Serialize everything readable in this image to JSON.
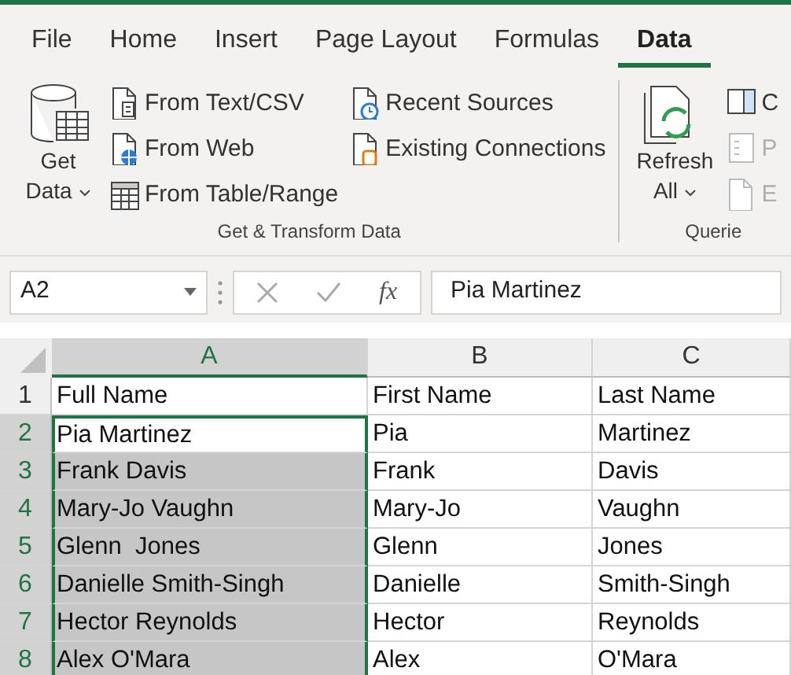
{
  "tabs": [
    {
      "label": "File",
      "selected": false
    },
    {
      "label": "Home",
      "selected": false
    },
    {
      "label": "Insert",
      "selected": false
    },
    {
      "label": "Page Layout",
      "selected": false
    },
    {
      "label": "Formulas",
      "selected": false
    },
    {
      "label": "Data",
      "selected": true
    }
  ],
  "ribbon": {
    "groups": [
      {
        "label": "Get & Transform Data",
        "large": [
          {
            "label": "Get Data",
            "caret": true
          }
        ],
        "columns": [
          [
            {
              "label": "From Text/CSV",
              "disabled": false
            },
            {
              "label": "From Web",
              "disabled": false
            },
            {
              "label": "From Table/Range",
              "disabled": false
            }
          ],
          [
            {
              "label": "Recent Sources",
              "disabled": false
            },
            {
              "label": "Existing Connections",
              "disabled": false
            }
          ]
        ]
      },
      {
        "label": "Querie",
        "large": [
          {
            "label": "Refresh All",
            "caret": true
          }
        ],
        "columns": [
          [
            {
              "label": "C",
              "disabled": false
            },
            {
              "label": "P",
              "disabled": true
            },
            {
              "label": "E",
              "disabled": true
            }
          ]
        ]
      }
    ]
  },
  "formula_bar": {
    "name_box": "A2",
    "function_label": "fx",
    "value": "Pia Martinez"
  },
  "sheet": {
    "columns": [
      {
        "label": "A",
        "selected": true
      },
      {
        "label": "B",
        "selected": false
      },
      {
        "label": "C",
        "selected": false
      }
    ],
    "rows": [
      {
        "header": "1",
        "selected": false,
        "cells": [
          {
            "text": "Full Name",
            "selected": false,
            "active": false
          },
          {
            "text": "First Name",
            "selected": false,
            "active": false
          },
          {
            "text": "Last Name",
            "selected": false,
            "active": false
          }
        ]
      },
      {
        "header": "2",
        "selected": true,
        "cells": [
          {
            "text": "Pia Martinez",
            "selected": true,
            "active": true
          },
          {
            "text": "Pia",
            "selected": false,
            "active": false
          },
          {
            "text": "Martinez",
            "selected": false,
            "active": false
          }
        ]
      },
      {
        "header": "3",
        "selected": true,
        "cells": [
          {
            "text": "Frank Davis",
            "selected": true,
            "active": false
          },
          {
            "text": "Frank",
            "selected": false,
            "active": false
          },
          {
            "text": "Davis",
            "selected": false,
            "active": false
          }
        ]
      },
      {
        "header": "4",
        "selected": true,
        "cells": [
          {
            "text": "Mary-Jo Vaughn",
            "selected": true,
            "active": false
          },
          {
            "text": "Mary-Jo",
            "selected": false,
            "active": false
          },
          {
            "text": "Vaughn",
            "selected": false,
            "active": false
          }
        ]
      },
      {
        "header": "5",
        "selected": true,
        "cells": [
          {
            "text": "Glenn  Jones",
            "selected": true,
            "active": false
          },
          {
            "text": "Glenn",
            "selected": false,
            "active": false
          },
          {
            "text": "Jones",
            "selected": false,
            "active": false
          }
        ]
      },
      {
        "header": "6",
        "selected": true,
        "cells": [
          {
            "text": "Danielle Smith-Singh",
            "selected": true,
            "active": false
          },
          {
            "text": "Danielle",
            "selected": false,
            "active": false
          },
          {
            "text": "Smith-Singh",
            "selected": false,
            "active": false
          }
        ]
      },
      {
        "header": "7",
        "selected": true,
        "cells": [
          {
            "text": "Hector Reynolds",
            "selected": true,
            "active": false
          },
          {
            "text": "Hector",
            "selected": false,
            "active": false
          },
          {
            "text": "Reynolds",
            "selected": false,
            "active": false
          }
        ]
      },
      {
        "header": "8",
        "selected": true,
        "cells": [
          {
            "text": "Alex O'Mara",
            "selected": true,
            "active": false
          },
          {
            "text": "Alex",
            "selected": false,
            "active": false
          },
          {
            "text": "O'Mara",
            "selected": false,
            "active": false
          }
        ]
      }
    ]
  }
}
